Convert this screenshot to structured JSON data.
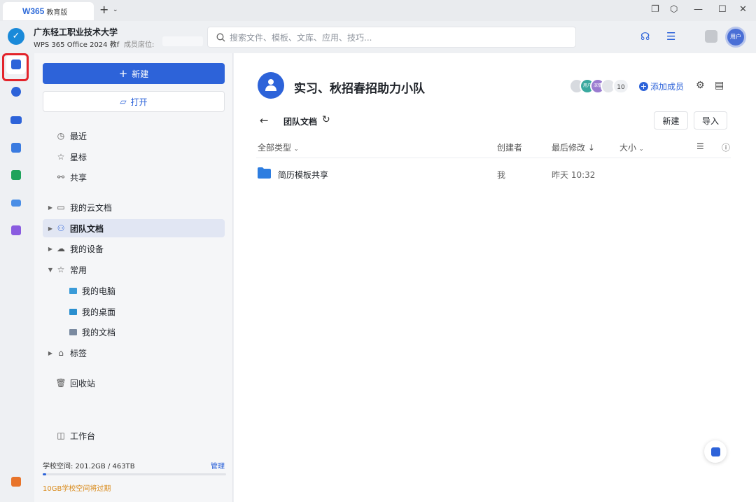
{
  "window": {
    "tab_logo": "W365",
    "tab_edition": "教育版",
    "new_tab": "+",
    "new_tab_dropdown": "⌄"
  },
  "header": {
    "org_name": "广东轻工职业技术大学",
    "org_subtitle": "WPS 365 Office 2024 教f",
    "seat_label": "成员席位: ",
    "search_placeholder": "搜索文件、模板、文库、应用、技巧...",
    "user_avatar_text": "用户"
  },
  "sidebar": {
    "new_label": "新建",
    "open_label": "打开",
    "quick": [
      {
        "label": "最近",
        "icon": "clock-icon",
        "glyph": "◷"
      },
      {
        "label": "星标",
        "icon": "star-icon",
        "glyph": "☆"
      },
      {
        "label": "共享",
        "icon": "share-icon",
        "glyph": "⚯"
      }
    ],
    "tree": [
      {
        "label": "我的云文档",
        "icon": "folder-icon",
        "glyph": "▭",
        "caret": "▶"
      },
      {
        "label": "团队文档",
        "icon": "team-icon",
        "glyph": "⚇",
        "caret": "▶",
        "active": true
      },
      {
        "label": "我的设备",
        "icon": "cloud-device-icon",
        "glyph": "☁",
        "caret": "▶"
      },
      {
        "label": "常用",
        "icon": "pin-icon",
        "glyph": "☆",
        "caret": "▼"
      }
    ],
    "common_items": [
      {
        "label": "我的电脑",
        "color": "#3a9bd8"
      },
      {
        "label": "我的桌面",
        "color": "#2a8fcf"
      },
      {
        "label": "我的文档",
        "color": "#7a8aa0"
      }
    ],
    "tags_label": "标签",
    "recycle_label": "回收站",
    "workbench_label": "工作台",
    "storage_text": "学校空间: 201.2GB / 463TB",
    "storage_used_fraction": 0.02,
    "manage_label": "管理",
    "expire_text": "10GB学校空间将过期"
  },
  "main": {
    "team_name": "实习、秋招春招助力小队",
    "member_count": "10",
    "member_avatars": [
      {
        "text": "",
        "color": "#d7dadf"
      },
      {
        "text": "用户",
        "color": "#3aa99f"
      },
      {
        "text": "深情",
        "color": "#9a7bd0"
      },
      {
        "text": "",
        "color": "#e3e5e9"
      }
    ],
    "add_member_label": "添加成员",
    "breadcrumb": "团队文档",
    "new_button": "新建",
    "import_button": "导入",
    "columns": {
      "type": "全部类型",
      "creator": "创建者",
      "modified": "最后修改",
      "size": "大小"
    },
    "files": [
      {
        "name": "简历模板共享",
        "creator": "我",
        "modified": "昨天 10:32"
      }
    ]
  },
  "colors": {
    "accent": "#2d63d9",
    "highlight_red": "#e3242b",
    "warning": "#d98a1a"
  }
}
